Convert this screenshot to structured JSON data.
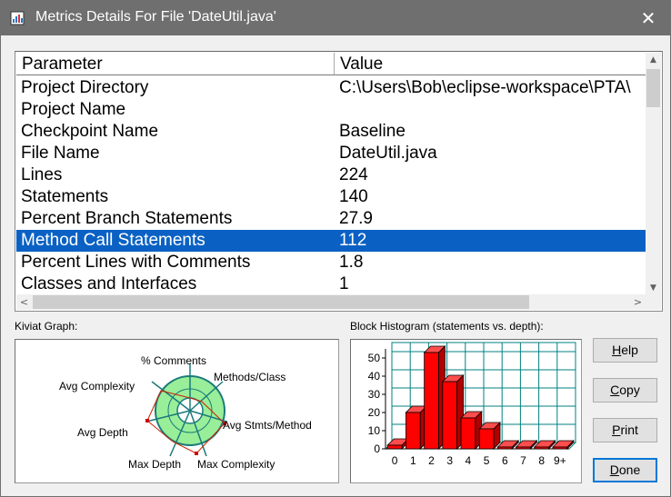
{
  "window": {
    "title": "Metrics Details For File 'DateUtil.java'"
  },
  "table": {
    "columns": [
      "Parameter",
      "Value"
    ],
    "rows": [
      {
        "parameter": "Project Directory",
        "value": "C:\\Users\\Bob\\eclipse-workspace\\PTA\\"
      },
      {
        "parameter": "Project Name",
        "value": ""
      },
      {
        "parameter": "Checkpoint Name",
        "value": "Baseline"
      },
      {
        "parameter": "File Name",
        "value": "DateUtil.java"
      },
      {
        "parameter": "Lines",
        "value": "224"
      },
      {
        "parameter": "Statements",
        "value": "140"
      },
      {
        "parameter": "Percent Branch Statements",
        "value": "27.9"
      },
      {
        "parameter": "Method Call Statements",
        "value": "112"
      },
      {
        "parameter": "Percent Lines with Comments",
        "value": "1.8"
      },
      {
        "parameter": "Classes and Interfaces",
        "value": "1"
      }
    ],
    "selected_index": 7
  },
  "kiviat": {
    "label": "Kiviat Graph:",
    "axes": [
      "% Comments",
      "Methods/Class",
      "Avg Stmts/Method",
      "Max Complexity",
      "Max Depth",
      "Avg Depth",
      "Avg Complexity"
    ]
  },
  "histogram": {
    "label": "Block Histogram (statements vs. depth):"
  },
  "buttons": {
    "help": {
      "pre": "",
      "key": "H",
      "post": "elp"
    },
    "copy": {
      "pre": "",
      "key": "C",
      "post": "opy"
    },
    "print": {
      "pre": "",
      "key": "P",
      "post": "rint"
    },
    "done": {
      "pre": "",
      "key": "D",
      "post": "one"
    }
  },
  "colors": {
    "selection": "#0a61c3",
    "bar": "#ff0000",
    "kiviat_fill": "#99ee99",
    "kiviat_accent": "#008080"
  },
  "chart_data": {
    "type": "bar",
    "categories": [
      "0",
      "1",
      "2",
      "3",
      "4",
      "5",
      "6",
      "7",
      "8",
      "9+"
    ],
    "values": [
      2,
      20,
      53,
      37,
      17,
      11,
      1,
      1,
      1,
      1
    ],
    "yticks": [
      0,
      10,
      20,
      30,
      40,
      50
    ],
    "ylim": [
      0,
      55
    ],
    "grid": true
  }
}
